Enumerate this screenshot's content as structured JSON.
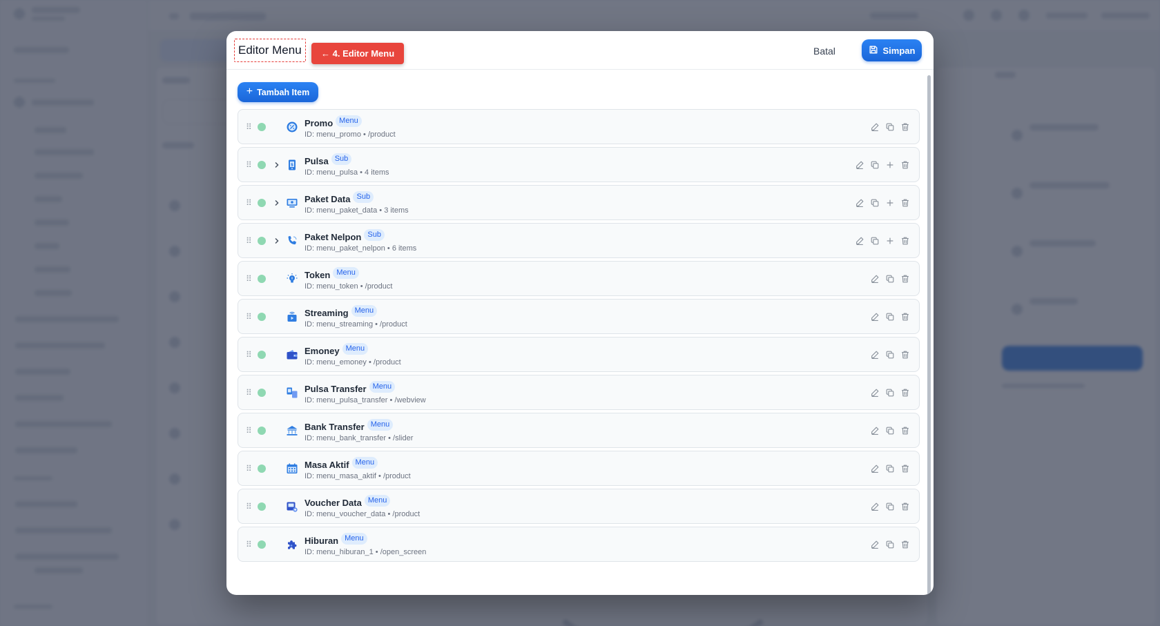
{
  "modal": {
    "title": "Editor Menu",
    "step_badge": "← 4. Editor Menu",
    "cancel_label": "Batal",
    "save_label": "Simpan",
    "add_item_label": "Tambah Item"
  },
  "id_prefix": "ID:",
  "separator": "•",
  "items": [
    {
      "name": "Promo",
      "badge": "Menu",
      "id": "menu_promo",
      "detail": "/product",
      "expandable": false,
      "icon": "promo-icon",
      "status": "active"
    },
    {
      "name": "Pulsa",
      "badge": "Sub",
      "id": "menu_pulsa",
      "detail": "4 items",
      "expandable": true,
      "icon": "pulsa-icon",
      "status": "active"
    },
    {
      "name": "Paket Data",
      "badge": "Sub",
      "id": "menu_paket_data",
      "detail": "3 items",
      "expandable": true,
      "icon": "paket-data-icon",
      "status": "active"
    },
    {
      "name": "Paket Nelpon",
      "badge": "Sub",
      "id": "menu_paket_nelpon",
      "detail": "6 items",
      "expandable": true,
      "icon": "phone-icon",
      "status": "active"
    },
    {
      "name": "Token",
      "badge": "Menu",
      "id": "menu_token",
      "detail": "/product",
      "expandable": false,
      "icon": "bulb-icon",
      "status": "active"
    },
    {
      "name": "Streaming",
      "badge": "Menu",
      "id": "menu_streaming",
      "detail": "/product",
      "expandable": false,
      "icon": "tv-icon",
      "status": "active"
    },
    {
      "name": "Emoney",
      "badge": "Menu",
      "id": "menu_emoney",
      "detail": "/product",
      "expandable": false,
      "icon": "wallet-icon",
      "status": "active"
    },
    {
      "name": "Pulsa Transfer",
      "badge": "Menu",
      "id": "menu_pulsa_transfer",
      "detail": "/webview",
      "expandable": false,
      "icon": "transfer-icon",
      "status": "active"
    },
    {
      "name": "Bank Transfer",
      "badge": "Menu",
      "id": "menu_bank_transfer",
      "detail": "/slider",
      "expandable": false,
      "icon": "bank-icon",
      "status": "active"
    },
    {
      "name": "Masa Aktif",
      "badge": "Menu",
      "id": "menu_masa_aktif",
      "detail": "/product",
      "expandable": false,
      "icon": "calendar-icon",
      "status": "active"
    },
    {
      "name": "Voucher Data",
      "badge": "Menu",
      "id": "menu_voucher_data",
      "detail": "/product",
      "expandable": false,
      "icon": "voucher-icon",
      "status": "active"
    },
    {
      "name": "Hiburan",
      "badge": "Menu",
      "id": "menu_hiburan_1",
      "detail": "/open_screen",
      "expandable": false,
      "icon": "puzzle-icon",
      "status": "active"
    }
  ],
  "colors": {
    "accent": "#1f6fe0",
    "status_active": "#8fd8b2",
    "badge_bg": "#deecfd",
    "badge_text": "#2563eb",
    "step_badge": "#e8453c"
  }
}
